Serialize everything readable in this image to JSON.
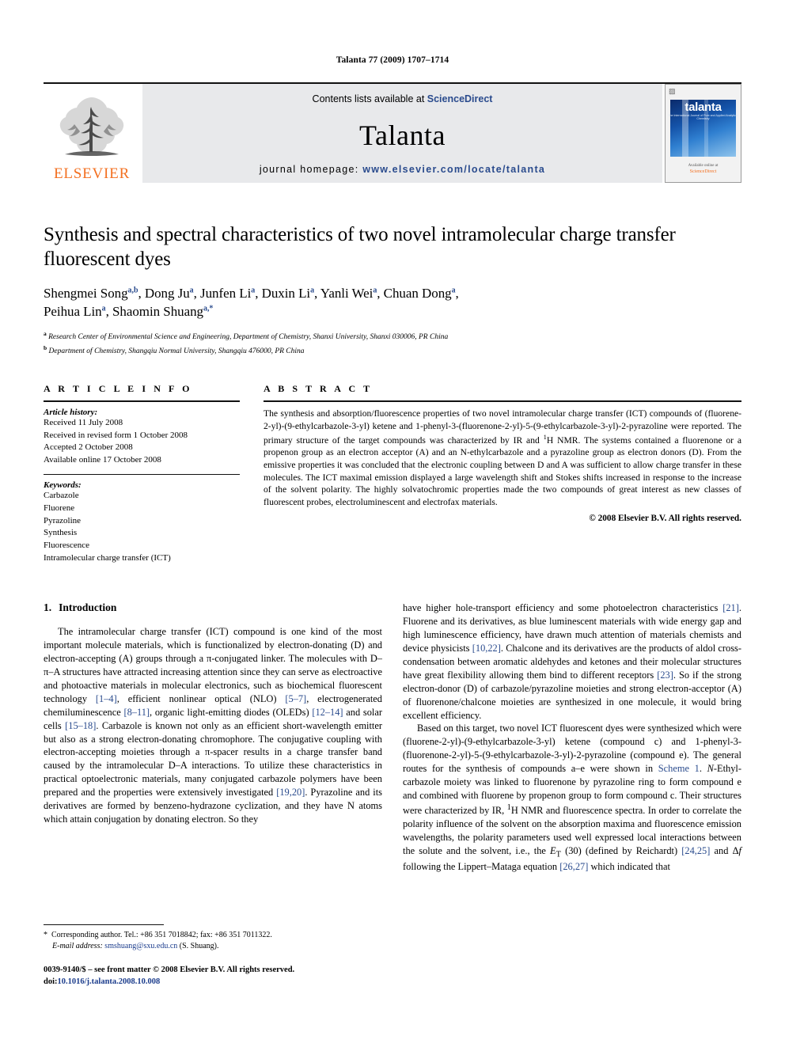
{
  "running_head": "Talanta 77 (2009) 1707–1714",
  "masthead": {
    "publisher": "ELSEVIER",
    "contents_prefix": "Contents lists available at ",
    "contents_link": "ScienceDirect",
    "journal_name": "Talanta",
    "homepage_label": "journal homepage:",
    "homepage_url": "www.elsevier.com/locate/talanta",
    "cover_title": "talanta",
    "cover_subtitle": "The International Journal of Pure and Applied Analytical Chemistry",
    "cover_footer_1": "Available online at",
    "cover_footer_2": "ScienceDirect",
    "accent_orange": "#f37021",
    "link_blue": "#2a4b8d",
    "panel_gray": "#e8e9eb"
  },
  "article": {
    "title": "Synthesis and spectral characteristics of two novel intramolecular charge transfer fluorescent dyes",
    "authors_line_1": "Shengmei Song<sup>a,b</sup>, Dong Ju<sup>a</sup>, Junfen Li<sup>a</sup>, Duxin Li<sup>a</sup>, Yanli Wei<sup>a</sup>, Chuan Dong<sup>a</sup>,",
    "authors_line_2": "Peihua Lin<sup>a</sup>, Shaomin Shuang<sup>a,</sup><sup>*</sup>",
    "affiliation_a": "<sup>a</sup> Research Center of Environmental Science and Engineering, Department of Chemistry, Shanxi University, Shanxi 030006, PR China",
    "affiliation_b": "<sup>b</sup> Department of Chemistry, Shangqiu Normal University, Shangqiu 476000, PR China"
  },
  "article_info": {
    "heading": "A R T I C L E   I N F O",
    "history_label": "Article history:",
    "history": [
      "Received 11 July 2008",
      "Received in revised form 1 October 2008",
      "Accepted 2 October 2008",
      "Available online 17 October 2008"
    ],
    "keywords_label": "Keywords:",
    "keywords": [
      "Carbazole",
      "Fluorene",
      "Pyrazoline",
      "Synthesis",
      "Fluorescence",
      "Intramolecular charge transfer (ICT)"
    ]
  },
  "abstract": {
    "heading": "A B S T R A C T",
    "text": "The synthesis and absorption/fluorescence properties of two novel intramolecular charge transfer (ICT) compounds of (fluorene-2-yl)-(9-ethylcarbazole-3-yl) ketene and 1-phenyl-3-(fluorenone-2-yl)-5-(9-ethylcarbazole-3-yl)-2-pyrazoline were reported. The primary structure of the target compounds was characterized by IR and <sup>1</sup>H NMR. The systems contained a fluorenone or a propenon group as an electron acceptor (A) and an N-ethylcarbazole and a pyrazoline group as electron donors (D). From the emissive properties it was concluded that the electronic coupling between D and A was sufficient to allow charge transfer in these molecules. The ICT maximal emission displayed a large wavelength shift and Stokes shifts increased in response to the increase of the solvent polarity. The highly solvatochromic properties made the two compounds of great interest as new classes of fluorescent probes, electroluminescent and electrofax materials.",
    "copyright": "© 2008 Elsevier B.V. All rights reserved."
  },
  "introduction": {
    "number": "1.",
    "heading": "Introduction",
    "left_paragraph_1": "The intramolecular charge transfer (ICT) compound is one kind of the most important molecule materials, which is functionalized by electron-donating (D) and electron-accepting (A) groups through a π-conjugated linker. The molecules with D–π–A structures have attracted increasing attention since they can serve as electroactive and photoactive materials in molecular electronics, such as biochemical fluorescent technology <span class=\"ref\">[1–4]</span>, efficient nonlinear optical (NLO) <span class=\"ref\">[5–7]</span>, electrogenerated chemiluminescence <span class=\"ref\">[8–11]</span>, organic light-emitting diodes (OLEDs) <span class=\"ref\">[12–14]</span> and solar cells <span class=\"ref\">[15–18]</span>. Carbazole is known not only as an efficient short-wavelength emitter but also as a strong electron-donating chromophore. The conjugative coupling with electron-accepting moieties through a π-spacer results in a charge transfer band caused by the intramolecular D–A interactions. To utilize these characteristics in practical optoelectronic materials, many conjugated carbazole polymers have been prepared and the properties were extensively investigated <span class=\"ref\">[19,20]</span>. Pyrazoline and its derivatives are formed by benzeno-hydrazone cyclization, and they have N atoms which attain conjugation by donating electron. So they",
    "right_paragraph_1_cont": "have higher hole-transport efficiency and some photoelectron characteristics <span class=\"ref\">[21]</span>. Fluorene and its derivatives, as blue luminescent materials with wide energy gap and high luminescence efficiency, have drawn much attention of materials chemists and device physicists <span class=\"ref\">[10,22]</span>. Chalcone and its derivatives are the products of aldol cross-condensation between aromatic aldehydes and ketones and their molecular structures have great flexibility allowing them bind to different receptors <span class=\"ref\">[23]</span>. So if the strong electron-donor (D) of carbazole/pyrazoline moieties and strong electron-acceptor (A) of fluorenone/chalcone moieties are synthesized in one molecule, it would bring excellent efficiency.",
    "right_paragraph_2": "Based on this target, two novel ICT fluorescent dyes were synthesized which were (fluorene-2-yl)-(9-ethylcarbazole-3-yl) ketene (compound c) and 1-phenyl-3-(fluorenone-2-yl)-5-(9-ethylcarbazole-3-yl)-2-pyrazoline (compound e). The general routes for the synthesis of compounds a–e were shown in <span class=\"ref\">Scheme 1</span>. <span class=\"ital\">N</span>-Ethyl-carbazole moiety was linked to fluorenone by pyrazoline ring to form compound e and combined with fluorene by propenon group to form compound c. Their structures were characterized by IR, <sup>1</sup>H NMR and fluorescence spectra. In order to correlate the polarity influence of the solvent on the absorption maxima and fluorescence emission wavelengths, the polarity parameters used well expressed local interactions between the solute and the solvent, i.e., the <span class=\"ital\">E</span><sub>T</sub> (30) (defined by Reichardt) <span class=\"ref\">[24,25]</span> and Δ<span class=\"ital\">f</span> following the Lippert–Mataga equation <span class=\"ref\">[26,27]</span> which indicated that"
  },
  "footer": {
    "corresponding_marker": "*",
    "corresponding_text": "Corresponding author. Tel.: +86 351 7018842; fax: +86 351 7011322.",
    "email_label": "E-mail address:",
    "email": "smshuang@sxu.edu.cn",
    "email_owner": "(S. Shuang).",
    "imprint_line": "0039-9140/$ – see front matter © 2008 Elsevier B.V. All rights reserved.",
    "doi_label": "doi:",
    "doi_value": "10.1016/j.talanta.2008.10.008"
  }
}
